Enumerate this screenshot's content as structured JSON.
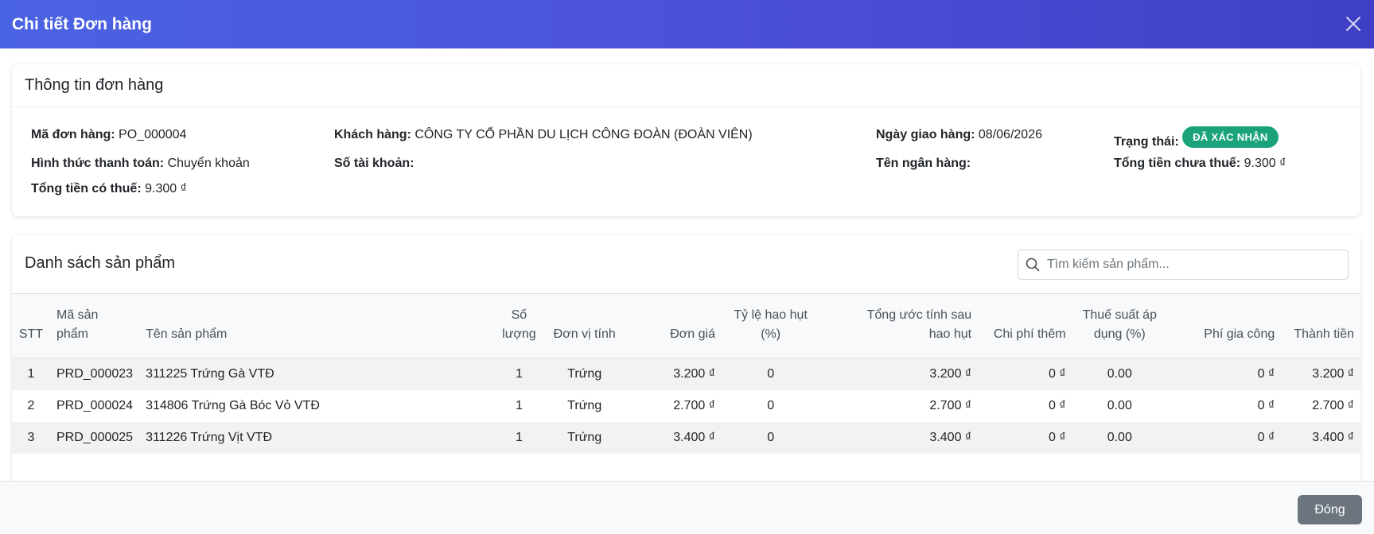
{
  "modal": {
    "title": "Chi tiết Đơn hàng",
    "close_label": "Đóng"
  },
  "order_info": {
    "section_title": "Thông tin đơn hàng",
    "order_code_label": "Mã đơn hàng:",
    "order_code": "PO_000004",
    "customer_label": "Khách hàng:",
    "customer": "CÔNG TY CỔ PHẦN DU LỊCH CÔNG ĐOÀN (ĐOÀN VIÊN)",
    "delivery_date_label": "Ngày giao hàng:",
    "delivery_date": "08/06/2026",
    "status_label": "Trạng thái:",
    "status": "ĐÃ XÁC NHẬN",
    "payment_method_label": "Hình thức thanh toán:",
    "payment_method": "Chuyển khoản",
    "account_number_label": "Số tài khoản:",
    "account_number": "",
    "bank_name_label": "Tên ngân hàng:",
    "bank_name": "",
    "subtotal_label": "Tổng tiền chưa thuế:",
    "subtotal": "9.300 ₫",
    "total_label": "Tổng tiền có thuế:",
    "total": "9.300 ₫"
  },
  "products": {
    "section_title": "Danh sách sản phẩm",
    "search_placeholder": "Tìm kiếm sản phẩm...",
    "columns": {
      "stt": "STT",
      "code_1": "Mã sản",
      "code_2": "phẩm",
      "name": "Tên sản phẩm",
      "qty_1": "Số",
      "qty_2": "lượng",
      "unit": "Đơn vị tính",
      "price": "Đơn giá",
      "loss_1": "Tỷ lệ hao hụt",
      "loss_2": "(%)",
      "est_1": "Tổng ước tính sau",
      "est_2": "hao hụt",
      "extra": "Chi phí thêm",
      "tax_1": "Thuế suất áp",
      "tax_2": "dụng (%)",
      "processing": "Phí gia công",
      "amount": "Thành tiền"
    },
    "rows": [
      {
        "stt": "1",
        "code": "PRD_000023",
        "name": "311225 Trứng Gà VTĐ",
        "qty": "1",
        "unit": "Trứng",
        "price": "3.200 ₫",
        "loss": "0",
        "est": "3.200 ₫",
        "extra": "0 ₫",
        "tax": "0.00",
        "processing": "0 ₫",
        "amount": "3.200 ₫"
      },
      {
        "stt": "2",
        "code": "PRD_000024",
        "name": "314806 Trứng Gà Bóc Vỏ VTĐ",
        "qty": "1",
        "unit": "Trứng",
        "price": "2.700 ₫",
        "loss": "0",
        "est": "2.700 ₫",
        "extra": "0 ₫",
        "tax": "0.00",
        "processing": "0 ₫",
        "amount": "2.700 ₫"
      },
      {
        "stt": "3",
        "code": "PRD_000025",
        "name": "311226 Trứng Vịt VTĐ",
        "qty": "1",
        "unit": "Trứng",
        "price": "3.400 ₫",
        "loss": "0",
        "est": "3.400 ₫",
        "extra": "0 ₫",
        "tax": "0.00",
        "processing": "0 ₫",
        "amount": "3.400 ₫"
      }
    ]
  },
  "colors": {
    "header_gradient_start": "#4a63e2",
    "header_gradient_end": "#3f3fc5",
    "status_badge": "#1aa37a",
    "close_button": "#6c757d"
  }
}
